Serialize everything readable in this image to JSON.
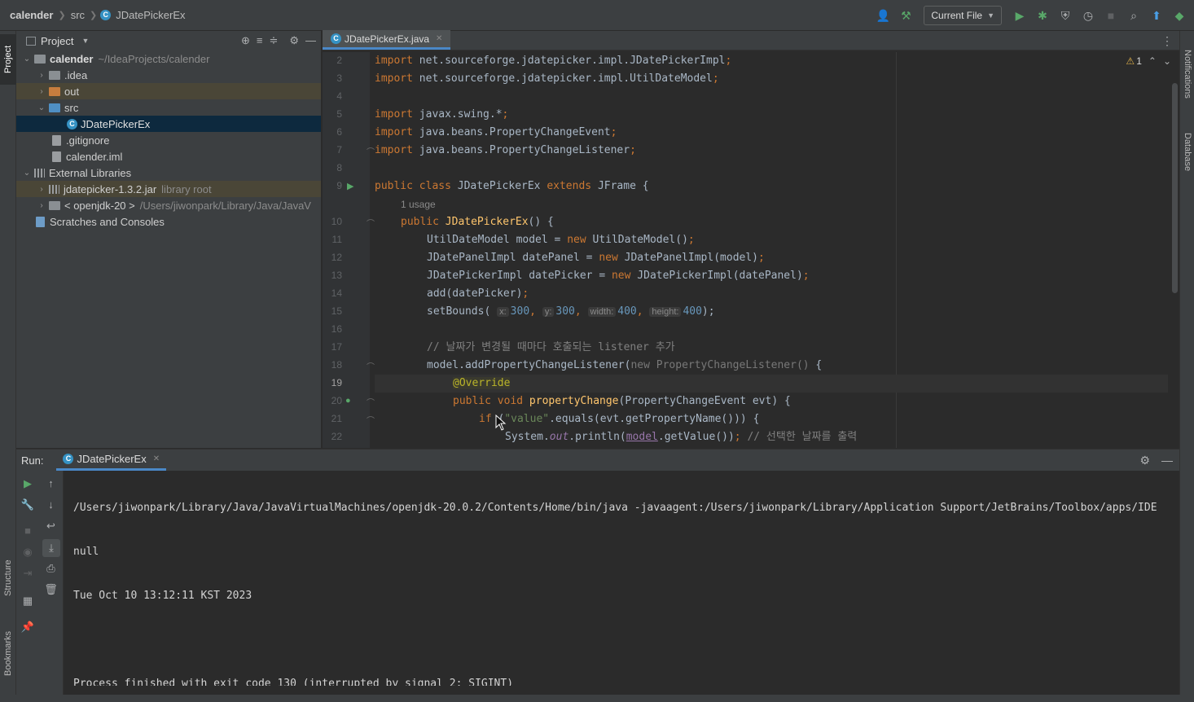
{
  "breadcrumb": {
    "project": "calender",
    "folder": "src",
    "file": "JDatePickerEx"
  },
  "toolbar": {
    "run_config": "Current File"
  },
  "left_strip": {
    "project_tab": "Project",
    "structure_tab": "Structure",
    "bookmarks_tab": "Bookmarks"
  },
  "right_strip": {
    "notifications_tab": "Notifications",
    "database_tab": "Database"
  },
  "project_panel": {
    "title": "Project",
    "tree": [
      {
        "label": "calender",
        "detail": "~/IdeaProjects/calender"
      },
      {
        "label": ".idea"
      },
      {
        "label": "out"
      },
      {
        "label": "src"
      },
      {
        "label": "JDatePickerEx"
      },
      {
        "label": ".gitignore"
      },
      {
        "label": "calender.iml"
      },
      {
        "label": "External Libraries"
      },
      {
        "label": "jdatepicker-1.3.2.jar",
        "detail": "library root"
      },
      {
        "label": "< openjdk-20 >",
        "detail": "/Users/jiwonpark/Library/Java/JavaV"
      },
      {
        "label": "Scratches and Consoles"
      }
    ]
  },
  "editor": {
    "tab_label": "JDatePickerEx.java",
    "warning_count": "1",
    "line_numbers": [
      "2",
      "3",
      "4",
      "5",
      "6",
      "7",
      "8",
      "9",
      "10",
      "11",
      "12",
      "13",
      "14",
      "15",
      "16",
      "17",
      "18",
      "19",
      "20",
      "21",
      "22"
    ],
    "code": {
      "l2a": "import",
      "l2b": " net.sourceforge.jdatepicker.impl.JDatePickerImpl",
      "l2c": ";",
      "l3a": "import",
      "l3b": " net.sourceforge.jdatepicker.impl.UtilDateModel",
      "l3c": ";",
      "l5a": "import",
      "l5b": " javax.swing.*",
      "l5c": ";",
      "l6a": "import",
      "l6b": " java.beans.PropertyChangeEvent",
      "l6c": ";",
      "l7a": "import",
      "l7b": " java.beans.PropertyChangeListener",
      "l7c": ";",
      "l9a": "public class",
      "l9b": " JDatePickerEx ",
      "l9c": "extends",
      "l9d": " JFrame {",
      "usage": "1 usage",
      "l10a": "public",
      "l10b": "JDatePickerEx",
      "l10c": "() {",
      "l11a": "UtilDateModel model = ",
      "l11b": "new",
      "l11c": " UtilDateModel()",
      "l11d": ";",
      "l12a": "JDatePanelImpl datePanel = ",
      "l12b": "new",
      "l12c": " JDatePanelImpl(model)",
      "l12d": ";",
      "l13a": "JDatePickerImpl datePicker = ",
      "l13b": "new",
      "l13c": " JDatePickerImpl(datePanel)",
      "l13d": ";",
      "l14a": "add(datePicker)",
      "l14b": ";",
      "l15a": "setBounds(",
      "l15h1": "x:",
      "l15v1": "300",
      "l15h2": "y:",
      "l15v2": "300",
      "l15h3": "width:",
      "l15v3": "400",
      "l15h4": "height:",
      "l15v4": "400",
      "l15e": ");",
      "l17": "// 날짜가 변경될 때마다 호출되는 listener 추가",
      "l18a": "model.addPropertyChangeListener(",
      "l18b": "new PropertyChangeListener()",
      "l18c": " {",
      "l19": "@Override",
      "l20a": "public void",
      "l20b": "propertyChange",
      "l20c": "(PropertyChangeEvent evt) {",
      "l21a": "if",
      "l21b": " (",
      "l21c": "\"value\"",
      "l21d": ".equals(evt.getPropertyName())) {",
      "l22a": "System.",
      "l22b": "out",
      "l22c": ".println(",
      "l22d": "model",
      "l22e": ".getValue())",
      "l22f": ";",
      "l22g": " // 선택한 날짜를 출력"
    }
  },
  "run_panel": {
    "label": "Run:",
    "tab_label": "JDatePickerEx",
    "console": [
      "/Users/jiwonpark/Library/Java/JavaVirtualMachines/openjdk-20.0.2/Contents/Home/bin/java -javaagent:/Users/jiwonpark/Library/Application Support/JetBrains/Toolbox/apps/IDE",
      "null",
      "Tue Oct 10 13:12:11 KST 2023",
      "",
      "Process finished with exit code 130 (interrupted by signal 2: SIGINT)"
    ]
  }
}
